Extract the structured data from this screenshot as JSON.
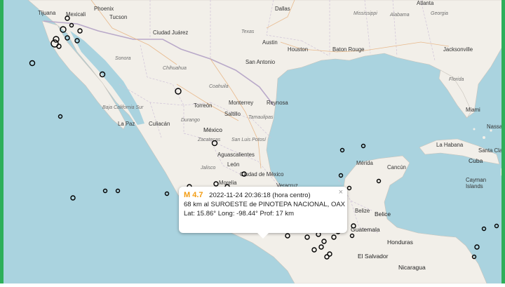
{
  "popup": {
    "magnitude": "M 4.7",
    "datetime": "2022-11-24   20:36:18 (hora centro)",
    "location": "68 km al SUROESTE de PINOTEPA NACIONAL, OAX",
    "coords": "Lat: 15.86°   Long: -98.44°   Prof: 17 km",
    "close": "×"
  },
  "colors": {
    "water": "#aad3df",
    "land": "#f2efe9",
    "border": "#b9a9c9",
    "frame": "#2eaf5a",
    "highlight": "#f39c12"
  },
  "map_labels": {
    "cities": [
      "Tijuana",
      "Mexicali",
      "Phoenix",
      "Tucson",
      "Dallas",
      "Atlanta",
      "Georgia",
      "Mississippi",
      "Alabama",
      "Ciudad Juárez",
      "Texas",
      "Austin",
      "Houston",
      "Baton Rouge",
      "Jacksonville",
      "San Antonio",
      "Florida",
      "Chihuahua",
      "Sonora",
      "Coahuila",
      "Torreón",
      "Monterrey",
      "Reynosa",
      "Saltillo",
      "Tamaulipas",
      "Durango",
      "Culiacán",
      "La Paz",
      "Baja California Sur",
      "México",
      "Zacatecas",
      "San Luis Potosí",
      "Aguascalientes",
      "León",
      "Morelia",
      "Ciudad de México",
      "Veracruz",
      "Mérida",
      "Cancún",
      "Belize",
      "Belice",
      "Guatemala",
      "Honduras",
      "El Salvador",
      "Nicaragua",
      "Miami",
      "Nassau",
      "La Habana",
      "Cuba",
      "Cayman Islands",
      "Santa Clara"
    ],
    "regions": [
      "Sonora",
      "Chihuahua",
      "Coahuila",
      "Durango",
      "Zacatecas",
      "Tamaulipas",
      "Texas",
      "Georgia",
      "Mississippi",
      "Alabama",
      "Florida",
      "Baja California Sur",
      "Jalisco"
    ]
  }
}
